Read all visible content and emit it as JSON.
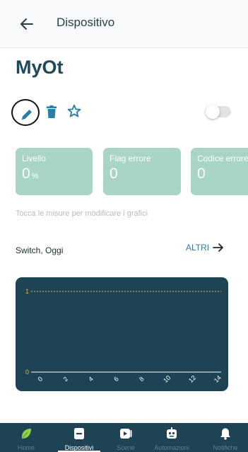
{
  "header": {
    "title": "Dispositivo",
    "back_icon": "arrow-left-icon"
  },
  "device": {
    "name": "MyOt",
    "favorite": false,
    "enabled": false
  },
  "actions": {
    "edit_icon": "pencil-icon",
    "delete_icon": "trash-icon",
    "favorite_icon": "star-outline-icon"
  },
  "measures": [
    {
      "label": "Livello",
      "value": "0",
      "unit": "%"
    },
    {
      "label": "Flag errore",
      "value": "0",
      "unit": ""
    },
    {
      "label": "Codice errore",
      "value": "0",
      "unit": ""
    }
  ],
  "hint": "Tocca le misure per modificare i grafici",
  "chart_section": {
    "title": "Switch, Oggi",
    "more_label": "ALTRI"
  },
  "chart_data": {
    "type": "line",
    "x": [
      0,
      2,
      4,
      6,
      8,
      10,
      12,
      14
    ],
    "x_tick_labels": [
      "0",
      "2",
      "4",
      "6",
      "8",
      "10",
      "12",
      "14"
    ],
    "y_tick_labels": [
      "0",
      "1"
    ],
    "ylim": [
      0,
      1
    ],
    "series": [],
    "dashed_reference_at": 1
  },
  "bottom_nav": {
    "items": [
      {
        "label": "Home",
        "icon": "leaf-icon",
        "active": false
      },
      {
        "label": "Dispositivi",
        "icon": "device-icon",
        "active": true
      },
      {
        "label": "Scene",
        "icon": "scene-icon",
        "active": false
      },
      {
        "label": "Automazioni",
        "icon": "robot-icon",
        "active": false
      },
      {
        "label": "Notifiche",
        "icon": "bell-icon",
        "active": false
      }
    ]
  },
  "colors": {
    "primary_dark": "#1e4355",
    "card_green": "#a8d5c4",
    "link_blue": "#2a7da8",
    "accent_yellow": "#d8b53a",
    "leaf_green": "#8fd14f"
  }
}
